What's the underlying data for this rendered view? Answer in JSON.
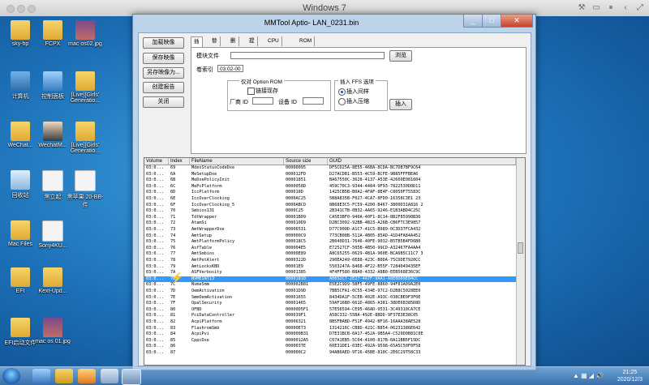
{
  "vm": {
    "title": "Windows 7"
  },
  "desktop_icons": [
    {
      "label": "sky-hp",
      "kind": "folder"
    },
    {
      "label": "FCPX",
      "kind": "folder"
    },
    {
      "label": "mac os02.jpg",
      "kind": "photo"
    },
    {
      "label": "计算机",
      "kind": "pc"
    },
    {
      "label": "控制面板",
      "kind": "cpanel"
    },
    {
      "label": "[Live][Girls' Generatio...",
      "kind": "folder"
    },
    {
      "label": "WeChat...",
      "kind": "folder"
    },
    {
      "label": "WechatM...",
      "kind": "person"
    },
    {
      "label": "[Live][Girls' Generatio...",
      "kind": "folder"
    },
    {
      "label": "回收站",
      "kind": "bin"
    },
    {
      "label": "黑立起",
      "kind": "file"
    },
    {
      "label": "黑苹果 20-BB-件",
      "kind": "file"
    },
    {
      "label": "Mac Files",
      "kind": "folder"
    },
    {
      "label": "Sony4KU...",
      "kind": "file"
    },
    {
      "label": "EFI",
      "kind": "folder"
    },
    {
      "label": "Kext-Upd...",
      "kind": "folder"
    },
    {
      "label": "EFI启动文件",
      "kind": "folder"
    },
    {
      "label": "mac os 01.jpg",
      "kind": "photo"
    }
  ],
  "window": {
    "title": "MMTool Aptio- LAN_0231.bin",
    "left_buttons": [
      "加载映像",
      "保存映像",
      "另存映像为...",
      "创建报告",
      "关闭"
    ],
    "tabs": [
      "插入",
      "替换",
      "删除",
      "提取",
      "CPU 补丁",
      "ROM 保留区"
    ],
    "active_tab": "插入",
    "insert": {
      "module_file_label": "模块文件",
      "module_file_value": "",
      "browse_label": "浏览",
      "volume_index_label": "卷索引",
      "volume_index_value": "03:02-00",
      "oprom_group": "仅对 Option ROM",
      "link_present": "链接现存",
      "vendor_id_label": "厂商 ID",
      "device_id_label": "设备 ID",
      "ffs_group": "插入 FFS 选项",
      "ffs_options": [
        "插入间样",
        "插入压缩"
      ],
      "ffs_selected": 0,
      "insert_button": "插入"
    },
    "table": {
      "columns": [
        "Volume",
        "Index",
        "FileName",
        "Source size",
        "GUID"
      ],
      "selected_index": 18,
      "rows": [
        [
          "03:0...",
          "69",
          "MdesStatusCodeDxe",
          "00000095",
          "DF5CD25A-8E55-46BA-8CDA-BC7DB7BF9C64"
        ],
        [
          "03:0...",
          "6A",
          "MeSetupDxe",
          "000012FD",
          "D27ACDB1-B553-4C59-BCFE-9B85FFFBEA6"
        ],
        [
          "03:0...",
          "6B",
          "MeDxePolicyInit",
          "00001851",
          "BA67550C-3628-4137-A53E-42660E081604"
        ],
        [
          "03:0...",
          "6C",
          "MePcPlatform",
          "0000058D",
          "459C70C3-9344-4484-9F93-7822530D0D11"
        ],
        [
          "03:0...",
          "6D",
          "IccPlatform",
          "000018D",
          "1425CB5B-B0A2-4FAF-8E4F-C8050F75583C"
        ],
        [
          "03:0...",
          "6E",
          "IccOverClocking",
          "0000AC25",
          "5B8A835B-F027-4CA7-8FD0-16358C3E1 23"
        ],
        [
          "03:0...",
          "6F",
          "IccOverClocking_5",
          "0000ABCD",
          "8B68E3C5-FC59-4200-B467-3800D31A816 2"
        ],
        [
          "03:0...",
          "70",
          "Smbios131",
          "0000C25",
          "2B341CTB-0B32-4A65-9246-E1B3ABD4C25C"
        ],
        [
          "03:0...",
          "71",
          "TdtWrapper",
          "00001B09",
          "CA5E3BF0-940A-40F1-8C14-8B2F85998B36"
        ],
        [
          "03:0...",
          "72",
          "AtamSi",
          "000010D9",
          "D2BC3092-92BB-4B23-A26B-CB6FTC3E9857"
        ],
        [
          "03:0...",
          "73",
          "AmtWrapperDxe",
          "00006531",
          "D77C900D-A1C7-41C5-B989-0C3D37FCA432"
        ],
        [
          "03:0...",
          "74",
          "AmtSetup",
          "000000C9",
          "773CB08B-511A-4B05-85AD-41D4FA84A452"
        ],
        [
          "03:0...",
          "75",
          "AmtPlatformPolicy",
          "000018C5",
          "2B040D31-7646-40FE-9032-B5TB5B4FD6B0"
        ],
        [
          "03:0...",
          "76",
          "AsfTable",
          "000004E5",
          "E72527CF-505B-4B50-99CD-A32467FA4AA4"
        ],
        [
          "03:0...",
          "77",
          "AmtSmbios",
          "00000E89",
          "A8C65255-0629-4B1A-960E-BCA6B5C11C7 3"
        ],
        [
          "03:0...",
          "78",
          "AmtPetAlert",
          "0000322D",
          "290EA249-6E88-423C-B0DA-75CDDE7920CC"
        ],
        [
          "03:0...",
          "79",
          "AmtLocksKBD",
          "00001E9",
          "5503247A-8468-4F22-B55F-7284049435EF"
        ],
        [
          "03:0...",
          "7A",
          "ASFVerbosity",
          "00001385",
          "4F4FF580-B8A0-4332-A8B0-EEB568E36C9C"
        ],
        [
          "03:0...",
          "7B",
          "NVMEINT13",
          "0000181D",
          "A0652C7-2E27-4A7F-9AA1-A0E0D09E84CC"
        ],
        [
          "03:0...",
          "7C",
          "NvmeSmm",
          "000002B81",
          "E5E2C9D9-5BF5-49FE-8860-94F81A09A2E0"
        ],
        [
          "03:0...",
          "7D",
          "OemActivation",
          "00001D9D",
          "7BB5CFA1-0C55-434E-97C2-D2B8C5028EE0"
        ],
        [
          "03:0...",
          "7E",
          "SmmOemActivation",
          "00001655",
          "8434DA1F-5CEB-402E-A93C-038CBE0F3F0E"
        ],
        [
          "03:0...",
          "7F",
          "OpalSecurity",
          "00001465",
          "59AF16B0-661D-4865-A381-38DE68385D8D"
        ],
        [
          "03:0...",
          "80",
          "OFBD",
          "00000D5F1",
          "57E56594-CE95-46AD-9531-3C49310CA7CE"
        ],
        [
          "03:0...",
          "81",
          "PciDataController",
          "000039F1",
          "A58C332-55BA-492E-8BDD-9F37E3E38C05"
        ],
        [
          "03:0...",
          "82",
          "AcpiPlatform",
          "00006321",
          "8B5FBABD-F51F-4942-BF16-16AAA38AE528"
        ],
        [
          "03:0...",
          "83",
          "FlashromSmb",
          "00000E73",
          "1314216C-CB8D-421C-B854-06231386E642"
        ],
        [
          "03:0...",
          "84",
          "AcpiPvi",
          "000000B31",
          "D7E31BCB-0A17-452A-9B5A4-C529D0B81C0E"
        ],
        [
          "03:0...",
          "85",
          "CppcDxe",
          "0000012A5",
          "C07A1EB5-5C04-4100-817B-0A11BB5F15DC"
        ],
        [
          "03:0...",
          "86",
          "",
          "000003TE",
          "60E31DE1-03EC-492A-9598-65A5C50F0F58"
        ],
        [
          "03:0...",
          "87",
          "",
          "000000C2",
          "94AB6AED-9T16-45BE-810C-2E6C29T58C33"
        ]
      ]
    }
  },
  "taskbar": {
    "time": "21:25",
    "date": "2020/12/3"
  }
}
